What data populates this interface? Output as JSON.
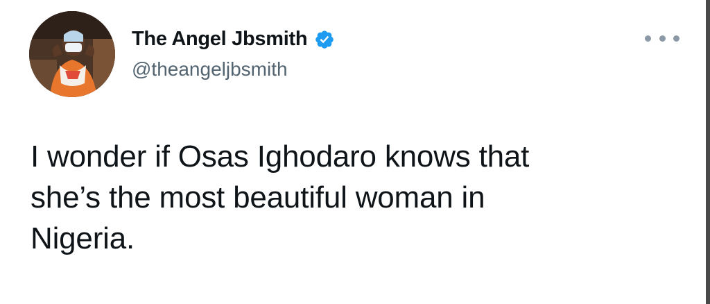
{
  "tweet": {
    "author": {
      "display_name": "The Angel Jbsmith",
      "handle": "@theangeljbsmith",
      "verified": true,
      "avatar_icon": "profile-photo"
    },
    "text": "I wonder if Osas Ighodaro knows that\nshe’s the most beautiful woman in\nNigeria.",
    "more_icon": "more-horizontal-icon"
  },
  "colors": {
    "verified_badge": "#1d9bf0",
    "handle_text": "#536471",
    "body_text": "#0f1419",
    "more_dots": "#8b98a5"
  }
}
